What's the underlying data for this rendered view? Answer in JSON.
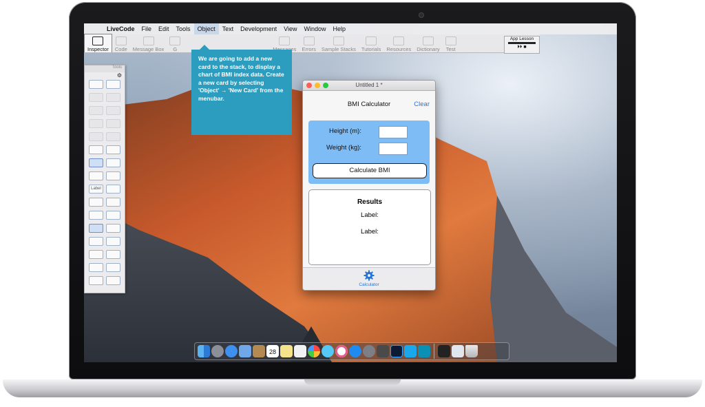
{
  "menubar": {
    "apple_icon": "apple-logo-icon",
    "items": [
      "LiveCode",
      "File",
      "Edit",
      "Tools",
      "Object",
      "Text",
      "Development",
      "View",
      "Window",
      "Help"
    ]
  },
  "toolbar": {
    "items": [
      "Inspector",
      "Code",
      "Message Box",
      "G",
      "",
      "",
      "Messages",
      "Errors",
      "Sample Stacks",
      "Tutorials",
      "Resources",
      "Dictionary",
      "Test"
    ],
    "lesson_label": "App Lesson"
  },
  "tools_palette": {
    "title": "Tools",
    "label_tool": "Label"
  },
  "callout": {
    "text": "We are going to add a new card to the stack, to display a chart of BMI index data. Create a new card by selecting 'Object' → 'New Card' from the menubar."
  },
  "stack_window": {
    "title": "Untitled 1 *",
    "app_title": "BMI Calculator",
    "clear_label": "Clear",
    "height_label": "Height (m):",
    "weight_label": "Weight (kg):",
    "height_value": "",
    "weight_value": "",
    "calculate_label": "Calculate BMI",
    "results_heading": "Results",
    "result_label_1": "Label:",
    "result_label_2": "Label:",
    "tab_label": "Calculator"
  },
  "dock": {
    "icons": [
      "finder-icon",
      "launchpad-icon",
      "safari-icon",
      "mail-icon",
      "contacts-icon",
      "calendar-icon",
      "notes-icon",
      "reminders-icon",
      "photos-icon",
      "messages-icon",
      "itunes-icon",
      "app-store-icon",
      "system-preferences-icon",
      "sublime-icon",
      "photoshop-icon",
      "skype-icon",
      "livecode-icon",
      "terminal-icon",
      "preview-icon",
      "trash-icon"
    ],
    "calendar_day": "28"
  },
  "colors": {
    "accent_blue": "#2774d4",
    "callout": "#2d9dbf",
    "input_panel": "#7ebcf5"
  }
}
